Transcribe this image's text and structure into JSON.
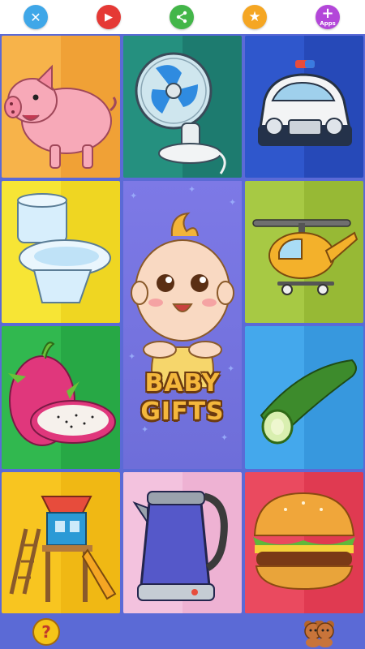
{
  "toolbar": {
    "buttons": [
      {
        "name": "close",
        "glyph": "✕",
        "color": "#3fa7e8"
      },
      {
        "name": "youtube",
        "glyph": "▶",
        "color": "#e53935"
      },
      {
        "name": "share",
        "glyph": "⤴",
        "color": "#43b649"
      },
      {
        "name": "rate",
        "glyph": "★",
        "color": "#f5a623"
      },
      {
        "name": "more-apps",
        "glyph": "+",
        "label": "Apps",
        "color": "#b347d9"
      }
    ]
  },
  "center": {
    "logo_text": "BABY GIFTS"
  },
  "tiles": [
    {
      "item": "pig",
      "bg": "#f2a33a"
    },
    {
      "item": "fan",
      "bg": "#22867a"
    },
    {
      "item": "police-car",
      "bg": "#2f54c8"
    },
    {
      "item": "toilet",
      "bg": "#f6df2e"
    },
    {
      "item": "helicopter",
      "bg": "#9fc23b"
    },
    {
      "item": "dragon-fruit",
      "bg": "#2cb34a"
    },
    {
      "item": "cucumber",
      "bg": "#3fa3e8"
    },
    {
      "item": "playground",
      "bg": "#f6c21b"
    },
    {
      "item": "kettle",
      "bg": "#f0b8d8"
    },
    {
      "item": "burger",
      "bg": "#e8445a"
    }
  ],
  "bottom": {
    "help_glyph": "?",
    "help_color": "#f5c518",
    "mascot": "teddy-bears"
  }
}
